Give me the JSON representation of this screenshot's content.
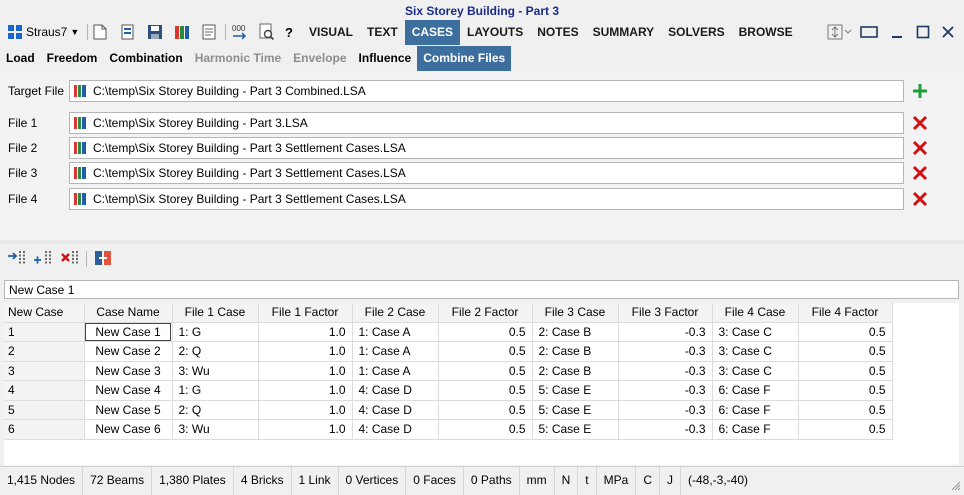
{
  "window": {
    "title": "Six Storey Building - Part 3"
  },
  "app": {
    "name": "Straus7"
  },
  "menu": [
    "VISUAL",
    "TEXT",
    "CASES",
    "LAYOUTS",
    "NOTES",
    "SUMMARY",
    "SOLVERS",
    "BROWSE"
  ],
  "toolbar_icons": [
    "new-file-icon",
    "open-file-icon",
    "save-icon",
    "library-icon",
    "report-icon",
    "numbering-icon",
    "search-document-icon",
    "help-icon"
  ],
  "help_glyph": "?",
  "subtabs": [
    {
      "label": "Load"
    },
    {
      "label": "Freedom"
    },
    {
      "label": "Combination"
    },
    {
      "label": "Harmonic Time"
    },
    {
      "label": "Envelope"
    },
    {
      "label": "Influence"
    },
    {
      "label": "Combine Files"
    }
  ],
  "files": {
    "target": {
      "label": "Target File",
      "path": "C:\\temp\\Six Storey Building - Part 3 Combined.LSA"
    },
    "list": [
      {
        "label": "File 1",
        "path": "C:\\temp\\Six Storey Building - Part 3.LSA"
      },
      {
        "label": "File 2",
        "path": "C:\\temp\\Six Storey Building - Part 3 Settlement Cases.LSA"
      },
      {
        "label": "File 3",
        "path": "C:\\temp\\Six Storey Building - Part 3 Settlement Cases.LSA"
      },
      {
        "label": "File 4",
        "path": "C:\\temp\\Six Storey Building - Part 3 Settlement Cases.LSA"
      }
    ]
  },
  "new_case_name": "New Case 1",
  "table": {
    "headers": [
      "New Case",
      "Case Name",
      "File 1 Case",
      "File 1 Factor",
      "File 2 Case",
      "File 2 Factor",
      "File 3 Case",
      "File 3 Factor",
      "File 4 Case",
      "File 4 Factor"
    ],
    "rows": [
      [
        "1",
        "New Case 1",
        "1: G",
        "1.0",
        "1: Case A",
        "0.5",
        "2: Case B",
        "-0.3",
        "3: Case C",
        "0.5"
      ],
      [
        "2",
        "New Case 2",
        "2: Q",
        "1.0",
        "1: Case A",
        "0.5",
        "2: Case B",
        "-0.3",
        "3: Case C",
        "0.5"
      ],
      [
        "3",
        "New Case 3",
        "3: Wu",
        "1.0",
        "1: Case A",
        "0.5",
        "2: Case B",
        "-0.3",
        "3: Case C",
        "0.5"
      ],
      [
        "4",
        "New Case 4",
        "1: G",
        "1.0",
        "4: Case D",
        "0.5",
        "5: Case E",
        "-0.3",
        "6: Case F",
        "0.5"
      ],
      [
        "5",
        "New Case 5",
        "2: Q",
        "1.0",
        "4: Case D",
        "0.5",
        "5: Case E",
        "-0.3",
        "6: Case F",
        "0.5"
      ],
      [
        "6",
        "New Case 6",
        "3: Wu",
        "1.0",
        "4: Case D",
        "0.5",
        "5: Case E",
        "-0.3",
        "6: Case F",
        "0.5"
      ]
    ]
  },
  "status": [
    "1,415 Nodes",
    "72 Beams",
    "1,380 Plates",
    "4 Bricks",
    "1 Link",
    "0 Vertices",
    "0 Faces",
    "0 Paths",
    "mm",
    "N",
    "t",
    "MPa",
    "C",
    "J",
    "(-48,-3,-40)"
  ],
  "colors": {
    "accent": "#3c6e9e",
    "title": "#1b2b8c",
    "add": "#1e9e3a",
    "remove": "#d01010"
  }
}
